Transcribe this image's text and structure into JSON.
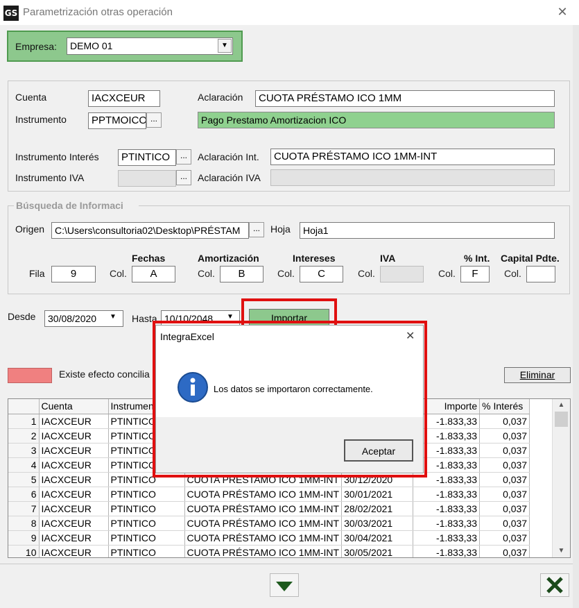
{
  "window": {
    "title": "Parametrización otras operación",
    "app_badge": "GS"
  },
  "empresa": {
    "label": "Empresa:",
    "value": "DEMO 01"
  },
  "cuenta": {
    "label": "Cuenta",
    "value": "IACXCEUR"
  },
  "aclaracion": {
    "label": "Aclaración",
    "value": "CUOTA PRÉSTAMO ICO 1MM"
  },
  "instrumento": {
    "label": "Instrumento",
    "value": "PPTMOICO",
    "description": "Pago Prestamo Amortizacion ICO"
  },
  "instrumento_interes": {
    "label": "Instrumento Interés",
    "value": "PTINTICO"
  },
  "aclaracion_int": {
    "label": "Aclaración Int.",
    "value": "CUOTA PRÉSTAMO ICO 1MM-INT"
  },
  "instrumento_iva": {
    "label": "Instrumento IVA",
    "value": ""
  },
  "aclaracion_iva": {
    "label": "Aclaración IVA",
    "value": ""
  },
  "busqueda": {
    "title": "Búsqueda de Informaci",
    "origen_label": "Origen",
    "origen_value": "C:\\Users\\consultoria02\\Desktop\\PRÉSTAM",
    "hoja_label": "Hoja",
    "hoja_value": "Hoja1",
    "fila_label": "Fila",
    "fila_value": "9",
    "col_label": "Col.",
    "headers": {
      "fechas": "Fechas",
      "amortizacion": "Amortización",
      "intereses": "Intereses",
      "iva": "IVA",
      "pint": "% Int.",
      "capital": "Capital Pdte."
    },
    "cols": {
      "fechas": "A",
      "amortizacion": "B",
      "intereses": "C",
      "iva": "",
      "pint": "F",
      "capital": ""
    }
  },
  "desde": {
    "label": "Desde",
    "value": "30/08/2020"
  },
  "hasta": {
    "label": "Hasta",
    "value": "10/10/2048"
  },
  "importar_label": "Importar",
  "legend_text": "Existe efecto concilia",
  "eliminar_label": "Eliminar",
  "colors": {
    "accent_green": "#8dc88d",
    "legend_red": "#f08080",
    "highlight_red": "#e01010"
  },
  "grid": {
    "columns": [
      "Cuenta",
      "Instrument",
      "",
      "",
      "Importe",
      "% Interés"
    ],
    "rows": [
      {
        "n": "1",
        "cuenta": "IACXCEUR",
        "instr": "PTINTICO",
        "aclar": "",
        "fecha": "",
        "importe": "-1.833,33",
        "interes": "0,037"
      },
      {
        "n": "2",
        "cuenta": "IACXCEUR",
        "instr": "PTINTICO",
        "aclar": "",
        "fecha": "",
        "importe": "-1.833,33",
        "interes": "0,037"
      },
      {
        "n": "3",
        "cuenta": "IACXCEUR",
        "instr": "PTINTICO",
        "aclar": "",
        "fecha": "",
        "importe": "-1.833,33",
        "interes": "0,037"
      },
      {
        "n": "4",
        "cuenta": "IACXCEUR",
        "instr": "PTINTICO",
        "aclar": "",
        "fecha": "",
        "importe": "-1.833,33",
        "interes": "0,037"
      },
      {
        "n": "5",
        "cuenta": "IACXCEUR",
        "instr": "PTINTICO",
        "aclar": "CUOTA PRÉSTAMO ICO 1MM-INT",
        "fecha": "30/12/2020",
        "importe": "-1.833,33",
        "interes": "0,037"
      },
      {
        "n": "6",
        "cuenta": "IACXCEUR",
        "instr": "PTINTICO",
        "aclar": "CUOTA PRÉSTAMO ICO 1MM-INT",
        "fecha": "30/01/2021",
        "importe": "-1.833,33",
        "interes": "0,037"
      },
      {
        "n": "7",
        "cuenta": "IACXCEUR",
        "instr": "PTINTICO",
        "aclar": "CUOTA PRÉSTAMO ICO 1MM-INT",
        "fecha": "28/02/2021",
        "importe": "-1.833,33",
        "interes": "0,037"
      },
      {
        "n": "8",
        "cuenta": "IACXCEUR",
        "instr": "PTINTICO",
        "aclar": "CUOTA PRÉSTAMO ICO 1MM-INT",
        "fecha": "30/03/2021",
        "importe": "-1.833,33",
        "interes": "0,037"
      },
      {
        "n": "9",
        "cuenta": "IACXCEUR",
        "instr": "PTINTICO",
        "aclar": "CUOTA PRÉSTAMO ICO 1MM-INT",
        "fecha": "30/04/2021",
        "importe": "-1.833,33",
        "interes": "0,037"
      },
      {
        "n": "10",
        "cuenta": "IACXCEUR",
        "instr": "PTINTICO",
        "aclar": "CUOTA PRÉSTAMO ICO 1MM-INT",
        "fecha": "30/05/2021",
        "importe": "-1.833,33",
        "interes": "0,037"
      }
    ]
  },
  "dialog": {
    "title": "IntegraExcel",
    "message": "Los datos se importaron correctamente.",
    "ok_label": "Aceptar",
    "icon": "info-icon"
  }
}
